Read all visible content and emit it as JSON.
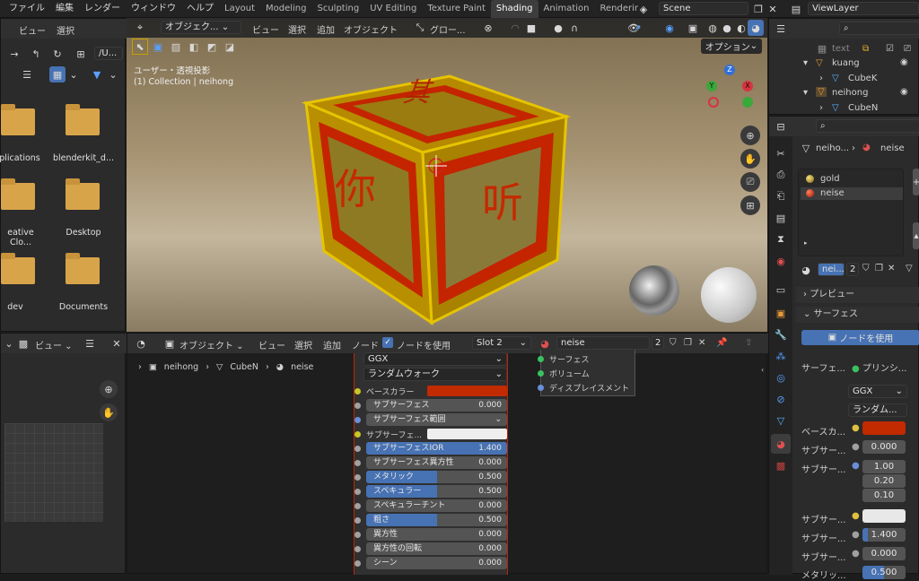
{
  "menu": [
    "ファイル",
    "編集",
    "レンダー",
    "ウィンドウ",
    "ヘルプ"
  ],
  "workspaces": [
    "Layout",
    "Modeling",
    "Sculpting",
    "UV Editing",
    "Texture Paint",
    "Shading",
    "Animation",
    "Renderir"
  ],
  "scene": "Scene",
  "viewlayer": "ViewLayer",
  "filebrowser": {
    "menu": [
      "ビュー",
      "選択"
    ],
    "path": "/U...",
    "items": [
      {
        "label": "plications"
      },
      {
        "label": "blenderkit_d..."
      },
      {
        "label": "eative Clo..."
      },
      {
        "label": "Desktop"
      },
      {
        "label": "dev"
      },
      {
        "label": "Documents"
      }
    ]
  },
  "viewport": {
    "mode": "オブジェク...",
    "menu": [
      "ビュー",
      "選択",
      "追加",
      "オブジェクト"
    ],
    "orientation": "グロー...",
    "options": "オプション",
    "overlay1": "ユーザー・透視投影",
    "overlay2": "(1) Collection | neihong",
    "gizmo": {
      "x": "X",
      "y": "Y",
      "z": "Z"
    },
    "cube_chars": {
      "top": "其",
      "left": "你",
      "right": "听"
    }
  },
  "outliner": {
    "items": [
      {
        "label": "text"
      },
      {
        "label": "kuang"
      },
      {
        "label": "CubeK"
      },
      {
        "label": "neihong"
      },
      {
        "label": "CubeN"
      }
    ]
  },
  "props": {
    "crumb1": "neiho...",
    "crumb2": "neise",
    "slots": [
      "gold",
      "neise"
    ],
    "mat_name": "nei...",
    "users": "2",
    "preview": "プレビュー",
    "surface": "サーフェス",
    "use_nodes": "ノードを使用",
    "surface_label": "サーフェ...",
    "surface_value": "プリンシ...",
    "ggx": "GGX",
    "random": "ランダム...",
    "rows": [
      {
        "label": "ベースカ...",
        "type": "color",
        "color": "#c22a00"
      },
      {
        "label": "サブサー...",
        "type": "num",
        "value": "0.000"
      },
      {
        "label": "サブサー...",
        "type": "vec",
        "values": [
          "1.00",
          "0.20",
          "0.10"
        ]
      },
      {
        "label": "サブサー...",
        "type": "color",
        "color": "#e8e8e8"
      },
      {
        "label": "サブサー...",
        "type": "numhl",
        "value": "1.400"
      },
      {
        "label": "サブサー...",
        "type": "num",
        "value": "0.000"
      },
      {
        "label": "メタリッ...",
        "type": "num",
        "value": "0.500"
      }
    ]
  },
  "nodeeditor": {
    "mode": "オブジェクト",
    "menu": [
      "ビュー",
      "選択",
      "追加",
      "ノード"
    ],
    "use_nodes": "ノードを使用",
    "slot": "Slot 2",
    "material": "neise",
    "users": "2",
    "crumb": [
      "neihong",
      "CubeN",
      "neise"
    ],
    "bsdf": {
      "ggx": "GGX",
      "random": "ランダムウォーク",
      "base": "ベースカラー",
      "base_color": "#c22a00",
      "sub_color": "#eeeeee",
      "rows": [
        {
          "label": "サブサーフェス",
          "value": "0.000",
          "fill": 0
        },
        {
          "label": "サブサーフェス範囲",
          "value": "",
          "fill": -1
        },
        {
          "label": "サブサーフェ...",
          "value": "",
          "fill": -2
        },
        {
          "label": "サブサーフェスIOR",
          "value": "1.400",
          "fill": 1
        },
        {
          "label": "サブサーフェス異方性",
          "value": "0.000",
          "fill": 0
        },
        {
          "label": "メタリック",
          "value": "0.500",
          "fill": 0.5
        },
        {
          "label": "スペキュラー",
          "value": "0.500",
          "fill": 0.5
        },
        {
          "label": "スペキュラーチント",
          "value": "0.000",
          "fill": 0
        },
        {
          "label": "粗さ",
          "value": "0.500",
          "fill": 0.5
        },
        {
          "label": "異方性",
          "value": "0.000",
          "fill": 0
        },
        {
          "label": "異方性の回転",
          "value": "0.000",
          "fill": 0
        },
        {
          "label": "シーン",
          "value": "0.000",
          "fill": 0
        }
      ]
    },
    "output": [
      "サーフェス",
      "ボリューム",
      "ディスプレイスメント"
    ]
  },
  "uv": {
    "menu": [
      "ビュー"
    ]
  }
}
